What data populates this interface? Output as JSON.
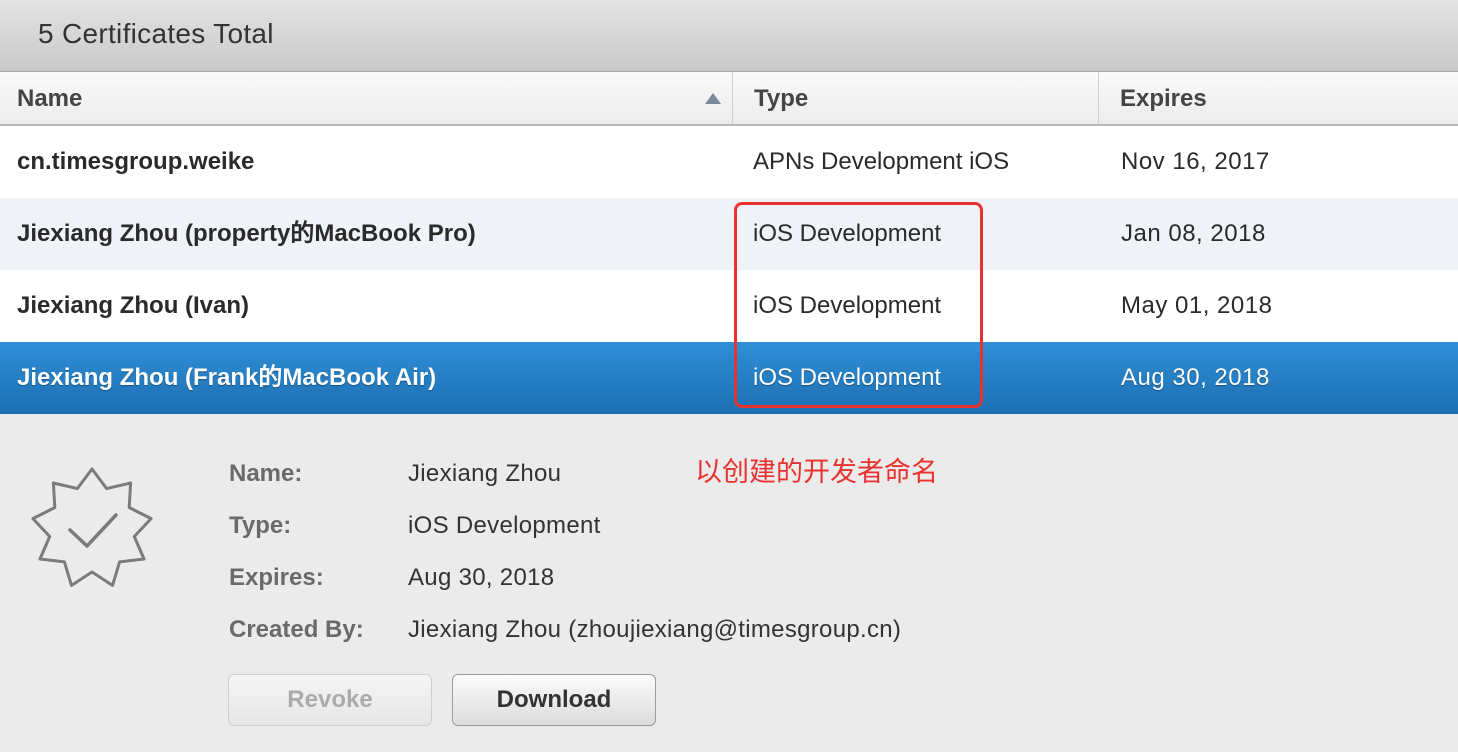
{
  "header": {
    "title": "5 Certificates Total"
  },
  "columns": {
    "name": "Name",
    "type": "Type",
    "expires": "Expires"
  },
  "rows": [
    {
      "name": "cn.timesgroup.weike",
      "type": "APNs Development iOS",
      "expires": "Nov 16, 2017"
    },
    {
      "name": "Jiexiang Zhou (property的MacBook Pro)",
      "type": "iOS Development",
      "expires": "Jan 08, 2018"
    },
    {
      "name": "Jiexiang Zhou (Ivan)",
      "type": "iOS Development",
      "expires": "May 01, 2018"
    },
    {
      "name": "Jiexiang Zhou (Frank的MacBook Air)",
      "type": "iOS Development",
      "expires": "Aug 30, 2018"
    }
  ],
  "selected_row_index": 3,
  "sort": {
    "column": "Name",
    "direction": "ascending"
  },
  "annotation": {
    "text": "以创建的开发者命名",
    "color": "#e8322f"
  },
  "details": {
    "name_label": "Name:",
    "name_value": "Jiexiang Zhou",
    "type_label": "Type:",
    "type_value": "iOS Development",
    "expires_label": "Expires:",
    "expires_value": "Aug 30, 2018",
    "created_label": "Created By:",
    "created_value": "Jiexiang Zhou (zhoujiexiang@timesgroup.cn)"
  },
  "buttons": {
    "revoke": "Revoke",
    "download": "Download"
  },
  "icons": {
    "certificate": "certificate-badge-icon",
    "sort": "sort-ascending-icon"
  },
  "colors": {
    "selection": "#1d6fb2",
    "annotation": "#e8322f"
  }
}
